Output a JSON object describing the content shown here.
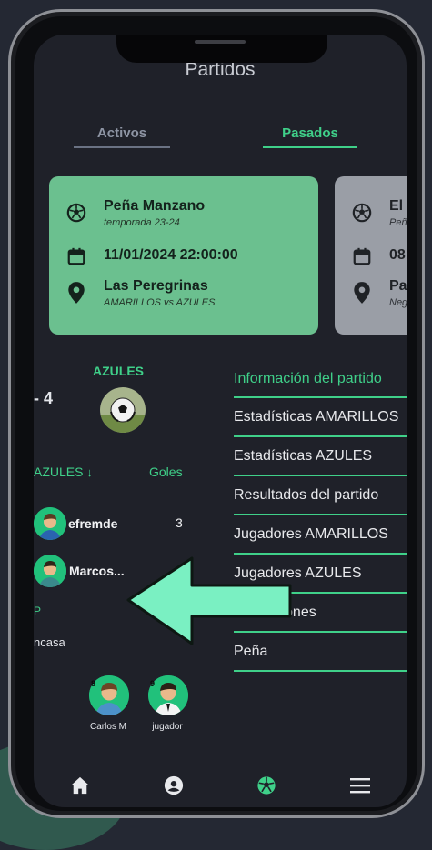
{
  "title": "Partidos",
  "tabs": [
    {
      "label": "Activos",
      "active": false
    },
    {
      "label": "Pasados",
      "active": true
    }
  ],
  "cards": [
    {
      "team": "Peña Manzano",
      "season": "temporada 23-24",
      "datetime": "11/01/2024 22:00:00",
      "venue": "Las Peregrinas",
      "matchup": "AMARILLOS vs AZULES",
      "bg": "#6bc08f"
    },
    {
      "team": "El",
      "season": "Peñ",
      "datetime": "08",
      "venue": "Pa",
      "matchup": "Neg",
      "bg": "#9a9ea6"
    }
  ],
  "match": {
    "team_name": "AZULES",
    "score": "- 4"
  },
  "players_table": {
    "header_team": "AZULES",
    "header_goals": "Goles",
    "rows": [
      {
        "name": "efremde",
        "goals": "3"
      },
      {
        "name": "Marcos...",
        "goals": ""
      }
    ],
    "extra": "ncasa"
  },
  "bench": [
    {
      "number": "8",
      "name": "Carlos M"
    },
    {
      "number": "9",
      "name": "jugador"
    }
  ],
  "menu": [
    "Información del partido",
    "Estadísticas AMARILLOS",
    "Estadísticas AZULES",
    "Resultados del partido",
    "Jugadores AMARILLOS",
    "Jugadores AZULES",
    "Alineaciones",
    "Peña"
  ],
  "nav": [
    "home-icon",
    "team-icon",
    "ball-icon",
    "menu-icon"
  ],
  "colors": {
    "accent": "#3fd089",
    "screen_bg": "#1f2129",
    "arrow": "#7af0c2"
  }
}
